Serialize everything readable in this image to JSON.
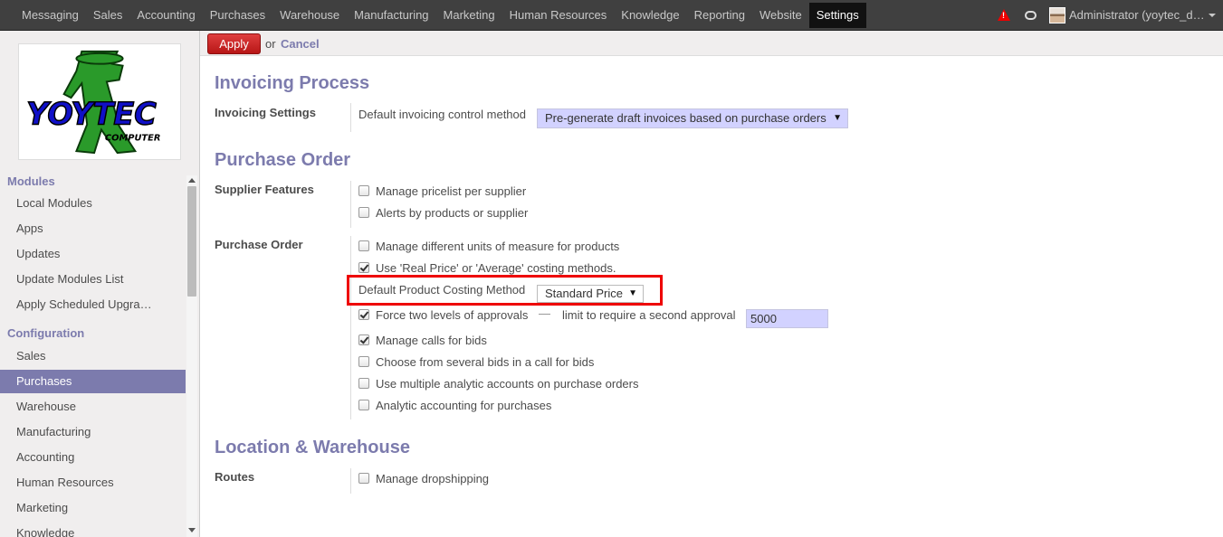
{
  "topbar": {
    "menu": [
      "Messaging",
      "Sales",
      "Accounting",
      "Purchases",
      "Warehouse",
      "Manufacturing",
      "Marketing",
      "Human Resources",
      "Knowledge",
      "Reporting",
      "Website",
      "Settings"
    ],
    "active": "Settings",
    "user": "Administrator (yoytec_demo)"
  },
  "sidebar": {
    "logo_text": "YOYTEC",
    "logo_subtext": "COMPUTER",
    "sections": [
      {
        "title": "Modules",
        "items": [
          "Local Modules",
          "Apps",
          "Updates",
          "Update Modules List",
          "Apply Scheduled Upgra…"
        ]
      },
      {
        "title": "Configuration",
        "items": [
          "Sales",
          "Purchases",
          "Warehouse",
          "Manufacturing",
          "Accounting",
          "Human Resources",
          "Marketing",
          "Knowledge"
        ]
      }
    ],
    "active_item": "Purchases"
  },
  "actionbar": {
    "apply": "Apply",
    "or": "or",
    "cancel": "Cancel"
  },
  "invoicing": {
    "title": "Invoicing Process",
    "group": "Invoicing Settings",
    "field_label": "Default invoicing control method",
    "field_value": "Pre-generate draft invoices based on purchase orders"
  },
  "purchase_order": {
    "title": "Purchase Order",
    "supplier_group": "Supplier Features",
    "supplier_options": [
      {
        "label": "Manage pricelist per supplier",
        "checked": false
      },
      {
        "label": "Alerts by products or supplier",
        "checked": false
      }
    ],
    "po_group": "Purchase Order",
    "opt_uom": {
      "label": "Manage different units of measure for products",
      "checked": false
    },
    "opt_costing": {
      "label": "Use 'Real Price' or 'Average' costing methods.",
      "checked": true
    },
    "costing_method_label": "Default Product Costing Method",
    "costing_method_value": "Standard Price",
    "opt_approvals": {
      "label": "Force two levels of approvals",
      "checked": true
    },
    "approval_limit_label": "limit to require a second approval",
    "approval_limit_value": "5000",
    "opt_calls": {
      "label": "Manage calls for bids",
      "checked": true
    },
    "opt_several_bids": {
      "label": "Choose from several bids in a call for bids",
      "checked": false
    },
    "opt_multi_analytic": {
      "label": "Use multiple analytic accounts on purchase orders",
      "checked": false
    },
    "opt_analytic": {
      "label": "Analytic accounting for purchases",
      "checked": false
    }
  },
  "location": {
    "title": "Location & Warehouse",
    "group": "Routes",
    "opt_dropship": {
      "label": "Manage dropshipping",
      "checked": false
    }
  },
  "colors": {
    "accent": "#7c7bad",
    "apply": "#dc1f1f",
    "highlight": "#ee0000",
    "topbar": "#404040"
  }
}
